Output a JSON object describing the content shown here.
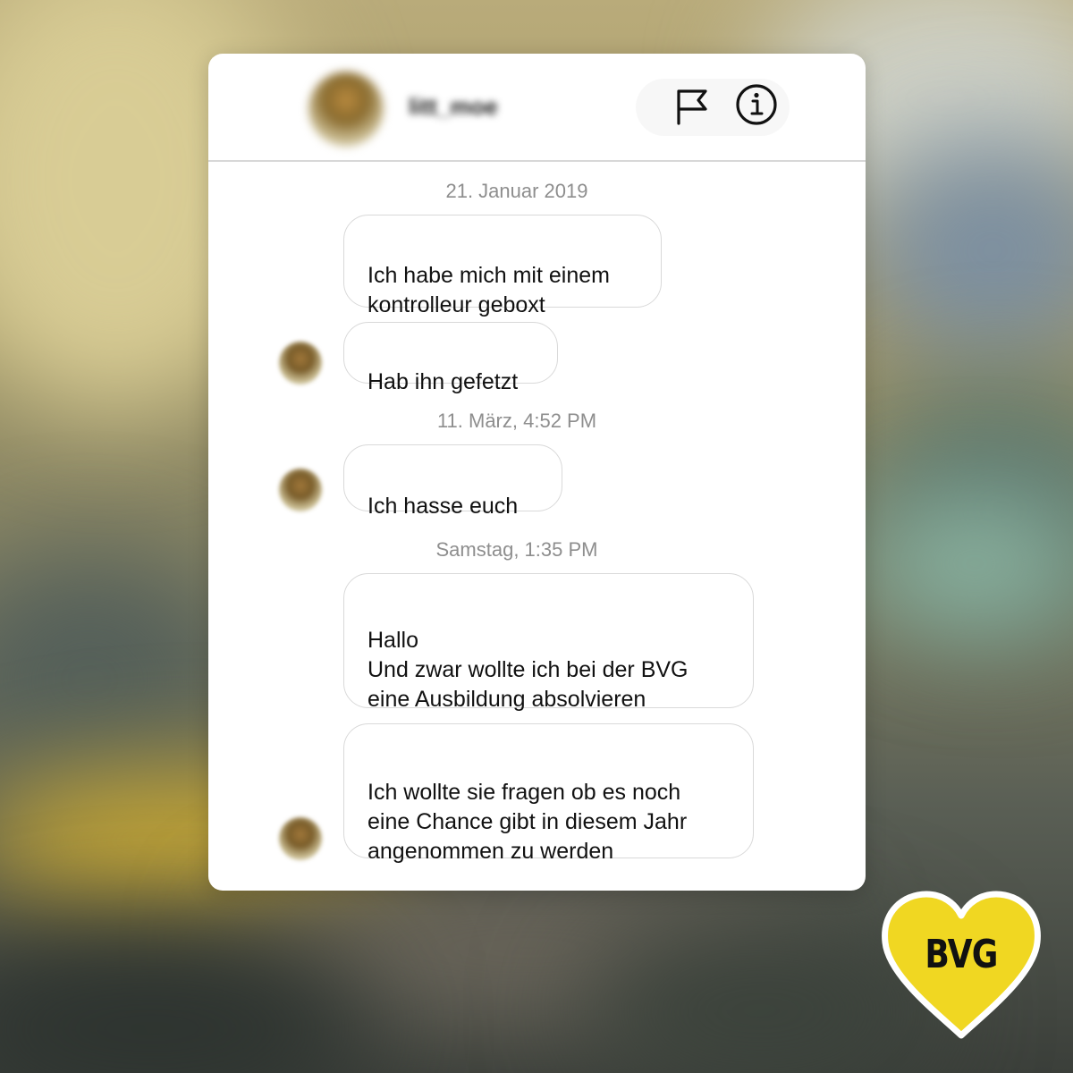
{
  "colors": {
    "bubble_border": "#d9d9d9",
    "date_text": "#8e8e8e",
    "divider": "#d8d8d8",
    "logo_yellow": "#f0d722"
  },
  "header": {
    "username": "litt_moe",
    "report_icon": "flag-icon",
    "info_icon": "info-icon"
  },
  "thread": {
    "groups": [
      {
        "date": "21. Januar 2019",
        "messages": [
          "Ich habe mich mit einem\nkontrolleur geboxt",
          "Hab ihn gefetzt"
        ]
      },
      {
        "date": "11. März, 4:52 PM",
        "messages": [
          "Ich hasse euch"
        ]
      },
      {
        "date": "Samstag, 1:35 PM",
        "messages": [
          "Hallo\nUnd zwar wollte ich bei der BVG\neine Ausbildung absolvieren",
          "Ich wollte sie fragen ob es noch\neine Chance gibt in diesem Jahr\nangenommen zu werden"
        ]
      }
    ]
  },
  "logo": {
    "text": "BVG"
  }
}
